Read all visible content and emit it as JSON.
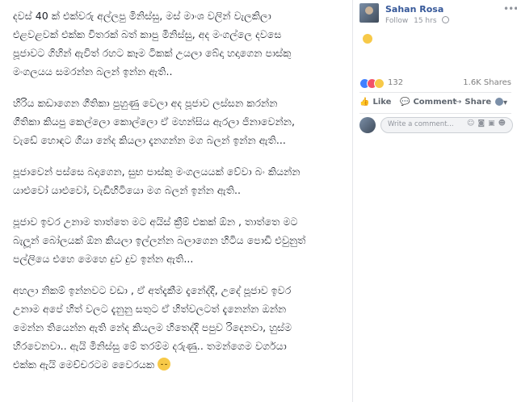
{
  "post": {
    "paragraphs": [
      "දවස් 40 ක් එක්වරු අල්ලපු මිනිස්සු, මස් මාංශ වලින් වැලකිලා\nඑළවළවක් එක්ක විතරක් බත් කාපු මිනිස්සු, අද මංගල්ලෙ දවසෙ\nපූජාවට ගිහින් ඇවිත් රහට කෑම ටිකක් උයලා බේදා හදාගෙන පාස්කු\nමංගලයය සමරන්න බලන් ඉන්න ඇති..",
      "හිරිය කඩාගෙන ගීතිකා පුහුණු වෙලා අද පූජාව ලස්සන කරන්න\nගීතිකා කියපු කෙල්ලො කොල්ලො ඒ මහන්සිය ඇරලා ජිනාවෙන්න,\nවැඩේ හොඳට ගියා නේද කියලා දැනගන්න මග බලන් ඉන්න ඇති...",
      "පූජාවෙන් පස්සෙ බදාගෙන, සුභ පාස්කු මංගලයයක් වේවා බං කියන්න\nයාළුවෝ යාළුවෝ, වැඩිහිටියො මග බලන් ඉන්න ඇති..",
      "පූජාව ඉවර උනාම තාත්තෙ මට අයිස් ක්‍රීම් එකක් ඕන , තාත්තෙ මට\nබැලූන් බෝලයක් ඕන කියලා ඉල්ලන්න බලාගෙන හිටිය පොඩි එවුනුත්\nපල්ලියෙ එහෙ මෙහෙ දුව දුව ඉන්න ඇති...",
      "අහලා නිකම් ඉන්නවට වඩා , ඒ අත්දැකීම දැනේද්දි, උදේ පූජාව ඉවර\nඋනාම අපේ හිත් වලට දැනුනු සතුට ඒ හිත්වලටත් දැනෙන්න ඔන්න\nමෙන්න තියෙන්න ඇති නේද කියලම හිතෙද්දි පපුව රිදෙනවා, හුස්ම\nහිරවෙනවා.. ඇයි මිනිස්සු මේ තරම්ම දරුණු.. තමන්ගෙම වර්ගයා\nඑක්ක ඇයි මෙච්චරටම වෛරයක"
    ]
  },
  "author": {
    "name": "Sahan Rosa",
    "follow_label": "Follow",
    "time": "15 hrs"
  },
  "stats": {
    "reaction_count": "132",
    "shares": "1.6K Shares"
  },
  "actions": {
    "like": "Like",
    "comment": "Comment",
    "share": "Share"
  },
  "comment": {
    "placeholder": "Write a comment..."
  },
  "icons": {
    "globe": "globe-icon",
    "more": "more-icon",
    "like": "thumbs-up-icon",
    "comment": "comment-icon",
    "share": "share-icon",
    "emoji": "sad-face-emoji-icon"
  },
  "colors": {
    "link": "#365899",
    "like": "#4080ff",
    "love": "#f25268",
    "emoji": "#f7c948"
  }
}
